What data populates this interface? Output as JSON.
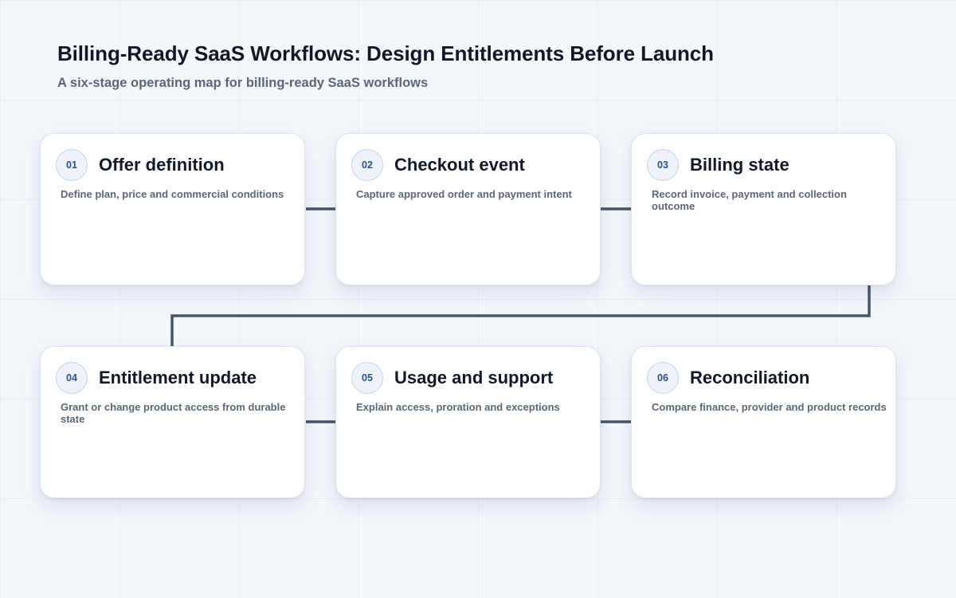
{
  "header": {
    "title": "Billing-Ready SaaS Workflows: Design Entitlements Before Launch",
    "subtitle": "A six-stage operating map for billing-ready SaaS workflows"
  },
  "colors": {
    "connector": "#475569",
    "badge_text": "#2f4f8a",
    "badge_border": "#c3d3ec",
    "card_border": "#dde3ec"
  },
  "stages": [
    {
      "number": "01",
      "title": "Offer definition",
      "description": "Define plan, price and commercial conditions"
    },
    {
      "number": "02",
      "title": "Checkout event",
      "description": "Capture approved order and payment intent"
    },
    {
      "number": "03",
      "title": "Billing state",
      "description": "Record invoice, payment and collection outcome"
    },
    {
      "number": "04",
      "title": "Entitlement update",
      "description": "Grant or change product access from durable state"
    },
    {
      "number": "05",
      "title": "Usage and support",
      "description": "Explain access, proration and exceptions"
    },
    {
      "number": "06",
      "title": "Reconciliation",
      "description": "Compare finance, provider and product records"
    }
  ]
}
